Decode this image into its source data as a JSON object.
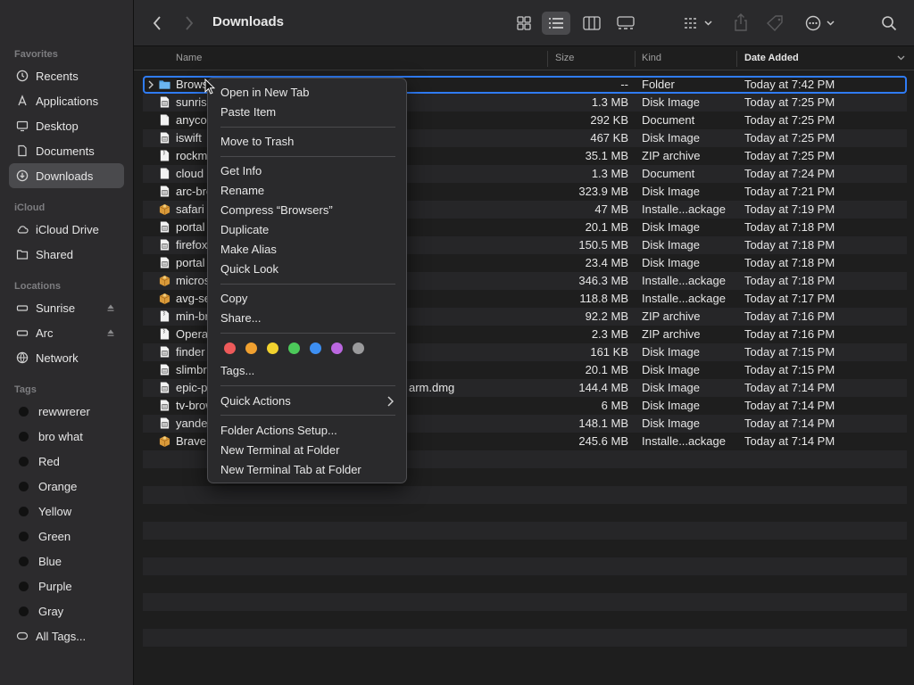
{
  "window": {
    "title": "Downloads"
  },
  "sidebar": {
    "favorites_heading": "Favorites",
    "favorites": [
      {
        "label": "Recents",
        "icon": "clock-icon"
      },
      {
        "label": "Applications",
        "icon": "applications-icon"
      },
      {
        "label": "Desktop",
        "icon": "desktop-icon"
      },
      {
        "label": "Documents",
        "icon": "document-icon"
      },
      {
        "label": "Downloads",
        "icon": "download-icon",
        "selected": true
      }
    ],
    "icloud_heading": "iCloud",
    "icloud": [
      {
        "label": "iCloud Drive",
        "icon": "cloud-icon"
      },
      {
        "label": "Shared",
        "icon": "shared-folder-icon"
      }
    ],
    "locations_heading": "Locations",
    "locations": [
      {
        "label": "Sunrise",
        "icon": "drive-icon",
        "eject": true
      },
      {
        "label": "Arc",
        "icon": "drive-icon",
        "eject": true
      },
      {
        "label": "Network",
        "icon": "network-icon"
      }
    ],
    "tags_heading": "Tags",
    "tags": [
      {
        "label": "rewwrerer"
      },
      {
        "label": "bro what"
      },
      {
        "label": "Red"
      },
      {
        "label": "Orange"
      },
      {
        "label": "Yellow"
      },
      {
        "label": "Green"
      },
      {
        "label": "Blue"
      },
      {
        "label": "Purple"
      },
      {
        "label": "Gray"
      },
      {
        "label": "All Tags...",
        "icon": "all-tags-icon"
      }
    ]
  },
  "columns": {
    "name": "Name",
    "size": "Size",
    "kind": "Kind",
    "date": "Date Added"
  },
  "rows": [
    {
      "name": "Browsers",
      "size": "--",
      "kind": "Folder",
      "date": "Today at 7:42 PM",
      "icon": "folder"
    },
    {
      "name": "sunrise",
      "size": "1.3 MB",
      "kind": "Disk Image",
      "date": "Today at 7:25 PM",
      "icon": "disk"
    },
    {
      "name": "anyconnect",
      "size": "292 KB",
      "kind": "Document",
      "date": "Today at 7:25 PM",
      "icon": "doc"
    },
    {
      "name": "iswift",
      "size": "467 KB",
      "kind": "Disk Image",
      "date": "Today at 7:25 PM",
      "icon": "disk"
    },
    {
      "name": "rockmelt",
      "size": "35.1 MB",
      "kind": "ZIP archive",
      "date": "Today at 7:25 PM",
      "icon": "zip"
    },
    {
      "name": "cloud",
      "size": "1.3 MB",
      "kind": "Document",
      "date": "Today at 7:24 PM",
      "icon": "doc"
    },
    {
      "name": "arc-browser",
      "size": "323.9 MB",
      "kind": "Disk Image",
      "date": "Today at 7:21 PM",
      "icon": "disk"
    },
    {
      "name": "safari",
      "size": "47 MB",
      "kind": "Installe...ackage",
      "date": "Today at 7:19 PM",
      "icon": "pkg"
    },
    {
      "name": "portal",
      "size": "20.1 MB",
      "kind": "Disk Image",
      "date": "Today at 7:18 PM",
      "icon": "disk"
    },
    {
      "name": "firefox",
      "size": "150.5 MB",
      "kind": "Disk Image",
      "date": "Today at 7:18 PM",
      "icon": "disk"
    },
    {
      "name": "portal",
      "size": "23.4 MB",
      "kind": "Disk Image",
      "date": "Today at 7:18 PM",
      "icon": "disk"
    },
    {
      "name": "microsoft",
      "size": "346.3 MB",
      "kind": "Installe...ackage",
      "date": "Today at 7:18 PM",
      "icon": "pkg"
    },
    {
      "name": "avg-secure",
      "size": "118.8 MB",
      "kind": "Installe...ackage",
      "date": "Today at 7:17 PM",
      "icon": "pkg"
    },
    {
      "name": "min-browser",
      "size": "92.2 MB",
      "kind": "ZIP archive",
      "date": "Today at 7:16 PM",
      "icon": "zip"
    },
    {
      "name": "Opera",
      "size": "2.3 MB",
      "kind": "ZIP archive",
      "date": "Today at 7:16 PM",
      "icon": "zip"
    },
    {
      "name": "finder",
      "size": "161 KB",
      "kind": "Disk Image",
      "date": "Today at 7:15 PM",
      "icon": "disk"
    },
    {
      "name": "slimbrowser",
      "size": "20.1 MB",
      "kind": "Disk Image",
      "date": "Today at 7:15 PM",
      "icon": "disk"
    },
    {
      "name": "epic-privacy",
      "extra": "arm.dmg",
      "size": "144.4 MB",
      "kind": "Disk Image",
      "date": "Today at 7:14 PM",
      "icon": "disk"
    },
    {
      "name": "tv-browser",
      "size": "6 MB",
      "kind": "Disk Image",
      "date": "Today at 7:14 PM",
      "icon": "disk"
    },
    {
      "name": "yandex",
      "size": "148.1 MB",
      "kind": "Disk Image",
      "date": "Today at 7:14 PM",
      "icon": "disk"
    },
    {
      "name": "Brave",
      "size": "245.6 MB",
      "kind": "Installe...ackage",
      "date": "Today at 7:14 PM",
      "icon": "pkg"
    }
  ],
  "context_menu": {
    "open_new_tab": "Open in New Tab",
    "paste_item": "Paste Item",
    "move_to_trash": "Move to Trash",
    "get_info": "Get Info",
    "rename": "Rename",
    "compress": "Compress “Browsers”",
    "duplicate": "Duplicate",
    "make_alias": "Make Alias",
    "quick_look": "Quick Look",
    "copy": "Copy",
    "share": "Share...",
    "tag_colors": [
      "#ee5a5a",
      "#f0a030",
      "#f2d22e",
      "#4cc95a",
      "#3d8ff2",
      "#bb67e0",
      "#9a9a9c"
    ],
    "tags": "Tags...",
    "quick_actions": "Quick Actions",
    "folder_actions_setup": "Folder Actions Setup...",
    "new_terminal": "New Terminal at Folder",
    "new_terminal_tab": "New Terminal Tab at Folder"
  }
}
